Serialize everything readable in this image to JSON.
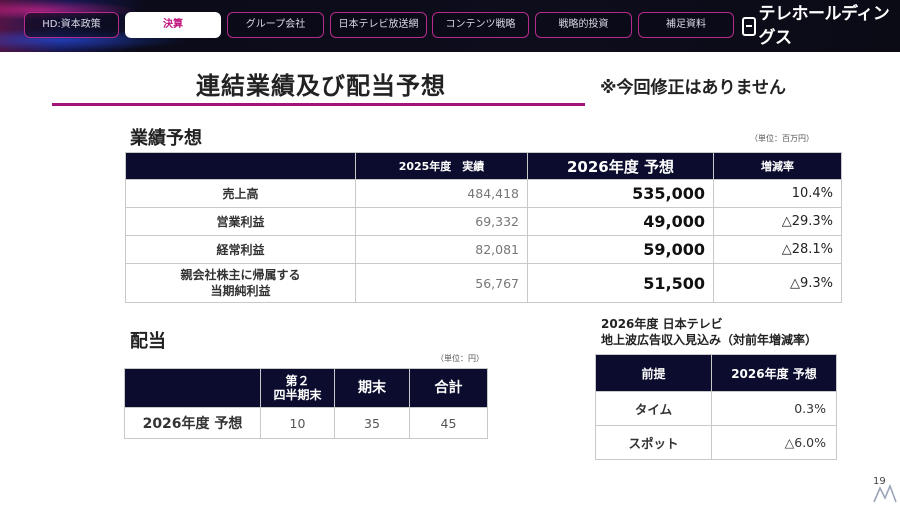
{
  "nav": {
    "tabs": [
      {
        "label": "HD:資本政策"
      },
      {
        "label": "決算"
      },
      {
        "label": "グループ会社"
      },
      {
        "label": "日本テレビ放送網"
      },
      {
        "label": "コンテンツ戦略"
      },
      {
        "label": "戦略的投資"
      },
      {
        "label": "補足資料"
      }
    ],
    "active_index": 1,
    "logo_text": "テレホールディングス",
    "accent_color": "#a3137a",
    "header_color": "#0b0c2e"
  },
  "title": "連結業績及び配当予想",
  "notice": "※今回修正はありません",
  "performance": {
    "heading": "業績予想",
    "unit": "（単位：百万円）",
    "columns": [
      "",
      "2025年度　実績",
      "2026年度 予想",
      "増減率"
    ],
    "rows": [
      {
        "label": "売上高",
        "label2": "",
        "actual": "484,418",
        "forecast": "535,000",
        "rate": "10.4%"
      },
      {
        "label": "営業利益",
        "label2": "",
        "actual": "69,332",
        "forecast": "49,000",
        "rate": "△29.3%"
      },
      {
        "label": "経常利益",
        "label2": "",
        "actual": "82,081",
        "forecast": "59,000",
        "rate": "△28.1%"
      },
      {
        "label": "親会社株主に帰属する",
        "label2": "当期純利益",
        "actual": "56,767",
        "forecast": "51,500",
        "rate": "△9.3%"
      }
    ]
  },
  "dividend": {
    "heading": "配当",
    "unit": "（単位：円）",
    "columns": [
      "",
      "第２",
      "四半期末",
      "期末",
      "合計"
    ],
    "row": {
      "label": "2026年度 予想",
      "q2": "10",
      "year_end": "35",
      "total": "45"
    }
  },
  "tv": {
    "caption_line1": "2026年度 日本テレビ",
    "caption_line2": "地上波広告収入見込み（対前年増減率）",
    "columns": [
      "前提",
      "2026年度 予想"
    ],
    "rows": [
      {
        "label": "タイム",
        "value": "0.3%"
      },
      {
        "label": "スポット",
        "value": "△6.0%"
      }
    ]
  },
  "page_number": "19"
}
